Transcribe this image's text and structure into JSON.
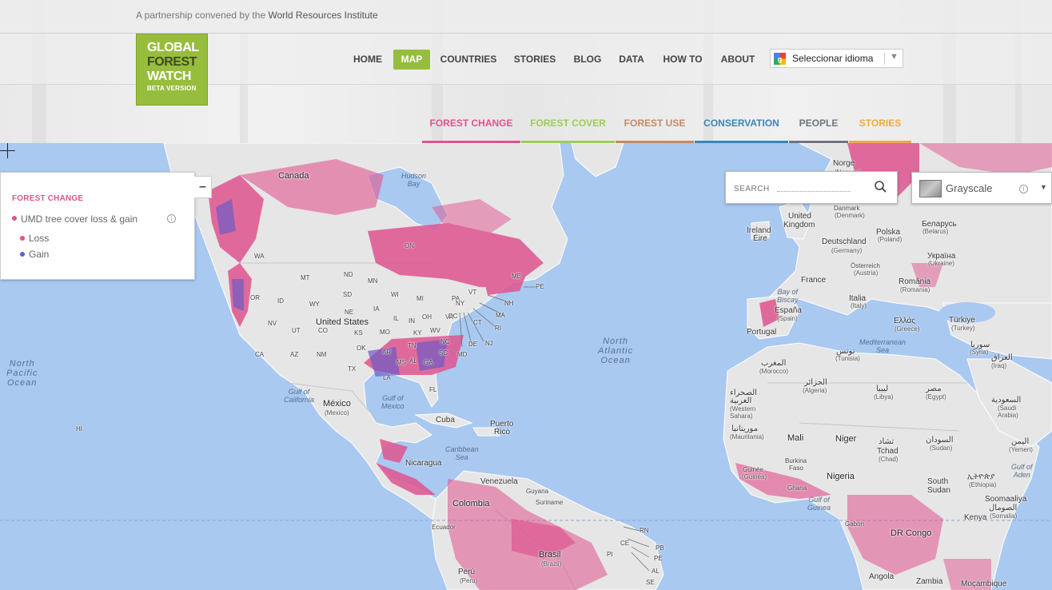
{
  "topbar": {
    "partner_prefix": "A partnership convened by the",
    "partner_name": "World Resources Institute"
  },
  "logo": {
    "line1": "GLOBAL",
    "line2": "FOREST",
    "line3": "WATCH",
    "line4": "BETA VERSION"
  },
  "nav": {
    "items": [
      {
        "label": "HOME",
        "active": false
      },
      {
        "label": "MAP",
        "active": true
      },
      {
        "label": "COUNTRIES",
        "active": false
      },
      {
        "label": "STORIES",
        "active": false
      },
      {
        "label": "BLOG",
        "active": false
      },
      {
        "label": "DATA",
        "active": false
      },
      {
        "label": "HOW TO",
        "active": false
      },
      {
        "label": "ABOUT",
        "active": false
      }
    ],
    "language": {
      "label": "Seleccionar idioma",
      "icon": "google-translate-icon"
    }
  },
  "subtabs": [
    {
      "label": "FOREST CHANGE",
      "color": "#e0538f"
    },
    {
      "label": "FOREST COVER",
      "color": "#9ecb5b"
    },
    {
      "label": "FOREST USE",
      "color": "#c58a64"
    },
    {
      "label": "CONSERVATION",
      "color": "#3a86b7"
    },
    {
      "label": "PEOPLE",
      "color": "#6e7480"
    },
    {
      "label": "STORIES",
      "color": "#f0a848"
    }
  ],
  "legend": {
    "title": "FOREST CHANGE",
    "layer": "UMD tree cover loss & gain",
    "items": [
      {
        "label": "Loss",
        "color": "#e0538f"
      },
      {
        "label": "Gain",
        "color": "#6d5bc4"
      }
    ],
    "collapse_label": "–"
  },
  "search": {
    "placeholder": "SEARCH"
  },
  "basemap": {
    "label": "Grayscale"
  },
  "map": {
    "countries": [
      {
        "label": "Canada",
        "cls": "lg"
      },
      {
        "label": "United States",
        "cls": "lg"
      },
      {
        "label": "México",
        "cls": "lg"
      },
      {
        "label": "(Mexico)",
        "cls": "sub"
      },
      {
        "label": "Cuba",
        "cls": ""
      },
      {
        "label": "Puerto",
        "cls": ""
      },
      {
        "label": "Rico",
        "cls": ""
      },
      {
        "label": "Nicaragua",
        "cls": ""
      },
      {
        "label": "Venezuela",
        "cls": ""
      },
      {
        "label": "Guyana",
        "cls": "sm"
      },
      {
        "label": "Suriname",
        "cls": "sm"
      },
      {
        "label": "Colombia",
        "cls": "lg"
      },
      {
        "label": "Ecuador",
        "cls": "sm"
      },
      {
        "label": "Brasil",
        "cls": "lg"
      },
      {
        "label": "(Brazil)",
        "cls": "sub"
      },
      {
        "label": "Perú",
        "cls": ""
      },
      {
        "label": "(Peru)",
        "cls": "sub"
      },
      {
        "label": "Norge",
        "cls": ""
      },
      {
        "label": "(Norway)",
        "cls": "sub"
      },
      {
        "label": "Danmark",
        "cls": "sm"
      },
      {
        "label": "(Denmark)",
        "cls": "sub"
      },
      {
        "label": "United",
        "cls": ""
      },
      {
        "label": "Kingdom",
        "cls": ""
      },
      {
        "label": "Ireland",
        "cls": ""
      },
      {
        "label": "Éire",
        "cls": ""
      },
      {
        "label": "Deutschland",
        "cls": ""
      },
      {
        "label": "(Germany)",
        "cls": "sub"
      },
      {
        "label": "Polska",
        "cls": ""
      },
      {
        "label": "(Poland)",
        "cls": "sub"
      },
      {
        "label": "Беларусь",
        "cls": ""
      },
      {
        "label": "(Belarus)",
        "cls": "sub"
      },
      {
        "label": "Україна",
        "cls": ""
      },
      {
        "label": "(Ukraine)",
        "cls": "sub"
      },
      {
        "label": "Österreich",
        "cls": "sm"
      },
      {
        "label": "(Austria)",
        "cls": "sub"
      },
      {
        "label": "France",
        "cls": ""
      },
      {
        "label": "România",
        "cls": ""
      },
      {
        "label": "(Romania)",
        "cls": "sub"
      },
      {
        "label": "Italia",
        "cls": ""
      },
      {
        "label": "(Italy)",
        "cls": "sub"
      },
      {
        "label": "España",
        "cls": ""
      },
      {
        "label": "(Spain)",
        "cls": "sub"
      },
      {
        "label": "Portugal",
        "cls": ""
      },
      {
        "label": "Ελλάς",
        "cls": ""
      },
      {
        "label": "(Greece)",
        "cls": "sub"
      },
      {
        "label": "Türkiye",
        "cls": ""
      },
      {
        "label": "(Turkey)",
        "cls": "sub"
      },
      {
        "label": "سوريا",
        "cls": ""
      },
      {
        "label": "(Syria)",
        "cls": "sub"
      },
      {
        "label": "العراق",
        "cls": ""
      },
      {
        "label": "(Iraq)",
        "cls": "sub"
      },
      {
        "label": "تونس",
        "cls": ""
      },
      {
        "label": "(Tunisia)",
        "cls": "sub"
      },
      {
        "label": "المغرب",
        "cls": ""
      },
      {
        "label": "(Morocco)",
        "cls": "sub"
      },
      {
        "label": "الجزائر",
        "cls": ""
      },
      {
        "label": "(Algeria)",
        "cls": "sub"
      },
      {
        "label": "ليبيا",
        "cls": ""
      },
      {
        "label": "(Libya)",
        "cls": "sub"
      },
      {
        "label": "مصر",
        "cls": ""
      },
      {
        "label": "(Egypt)",
        "cls": "sub"
      },
      {
        "label": "السعودية",
        "cls": ""
      },
      {
        "label": "(Saudi",
        "cls": "sub"
      },
      {
        "label": "Arabia)",
        "cls": "sub"
      },
      {
        "label": "الصحراء",
        "cls": ""
      },
      {
        "label": "الغربية",
        "cls": ""
      },
      {
        "label": "(Western",
        "cls": "sub"
      },
      {
        "label": "Sahara)",
        "cls": "sub"
      },
      {
        "label": "موريتانيا",
        "cls": ""
      },
      {
        "label": "(Mauritania)",
        "cls": "sub"
      },
      {
        "label": "Mali",
        "cls": "lg"
      },
      {
        "label": "Niger",
        "cls": "lg"
      },
      {
        "label": "تشاد",
        "cls": ""
      },
      {
        "label": "Tchad",
        "cls": ""
      },
      {
        "label": "(Chad)",
        "cls": "sub"
      },
      {
        "label": "السودان",
        "cls": ""
      },
      {
        "label": "(Sudan)",
        "cls": "sub"
      },
      {
        "label": "اليمن",
        "cls": ""
      },
      {
        "label": "(Yemen)",
        "cls": "sub"
      },
      {
        "label": "Burkina",
        "cls": "sm"
      },
      {
        "label": "Faso",
        "cls": "sm"
      },
      {
        "label": "Guinée",
        "cls": "sm"
      },
      {
        "label": "(Guinea)",
        "cls": "sub"
      },
      {
        "label": "Ghana",
        "cls": "sm"
      },
      {
        "label": "Nigeria",
        "cls": "lg"
      },
      {
        "label": "South",
        "cls": ""
      },
      {
        "label": "Sudan",
        "cls": ""
      },
      {
        "label": "ኢትዮጵያ",
        "cls": ""
      },
      {
        "label": "(Ethiopia)",
        "cls": "sub"
      },
      {
        "label": "Soomaaliya",
        "cls": ""
      },
      {
        "label": "الصومال",
        "cls": ""
      },
      {
        "label": "(Somalia)",
        "cls": "sub"
      },
      {
        "label": "Kenya",
        "cls": ""
      },
      {
        "label": "Gabon",
        "cls": "sm"
      },
      {
        "label": "DR Congo",
        "cls": "lg"
      },
      {
        "label": "Angola",
        "cls": ""
      },
      {
        "label": "Zambia",
        "cls": ""
      },
      {
        "label": "Moçambique",
        "cls": ""
      }
    ],
    "states": [
      "WA",
      "OR",
      "CA",
      "NV",
      "AZ",
      "UT",
      "ID",
      "MT",
      "WY",
      "CO",
      "NM",
      "ND",
      "SD",
      "NE",
      "KS",
      "OK",
      "TX",
      "MN",
      "IA",
      "MO",
      "AR",
      "LA",
      "WI",
      "IL",
      "MI",
      "IN",
      "OH",
      "KY",
      "TN",
      "MS",
      "AL",
      "GA",
      "FL",
      "SC",
      "NC",
      "VA",
      "WV",
      "PA",
      "NY",
      "VT",
      "NH",
      "ME",
      "MA",
      "RI",
      "CT",
      "NJ",
      "DE",
      "MD",
      "DC",
      "HI",
      "PE",
      "ON",
      "RN",
      "PB",
      "PE",
      "AL",
      "SE",
      "PI",
      "CE"
    ],
    "oceans": [
      {
        "label": "North\nPacific\nOcean"
      },
      {
        "label": "North\nAtlantic\nOcean"
      }
    ],
    "seas": [
      {
        "label": "Hudson\nBay"
      },
      {
        "label": "Gulf of\nCalifornia"
      },
      {
        "label": "Gulf of\nMexico"
      },
      {
        "label": "Caribbean\nSea"
      },
      {
        "label": "Bay of\nBiscay"
      },
      {
        "label": "Mediterranean\nSea"
      },
      {
        "label": "Gulf of\nGuinea"
      },
      {
        "label": "Gulf of\nAden"
      }
    ],
    "colors": {
      "water": "#a9c9f1",
      "land": "#e6e6e6",
      "loss": "#e0538f",
      "gain": "#6d5bc4"
    }
  }
}
